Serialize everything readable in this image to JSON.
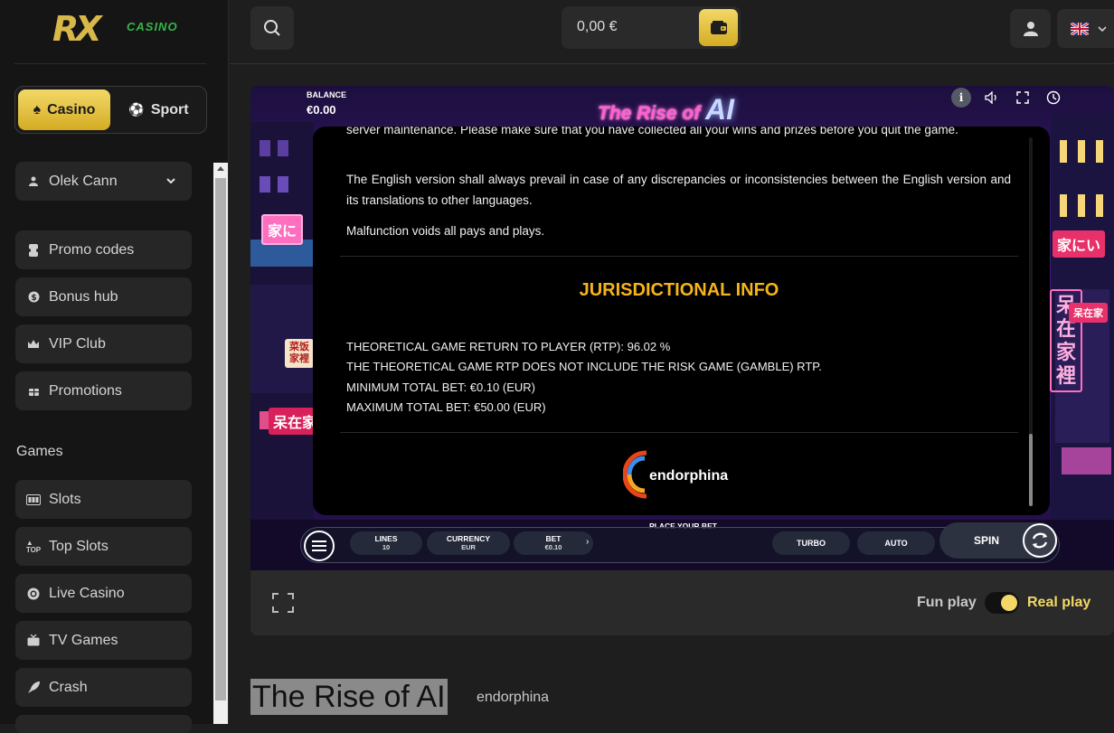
{
  "brand": {
    "logo_text": "RX",
    "logo_sub": "CASINO"
  },
  "mode_switch": {
    "casino_label": "Casino",
    "sport_label": "Sport"
  },
  "user": {
    "name": "Olek Cann"
  },
  "nav": {
    "items": [
      {
        "label": "Promo codes",
        "icon": "ticket-icon"
      },
      {
        "label": "Bonus hub",
        "icon": "coin-icon"
      },
      {
        "label": "VIP Club",
        "icon": "crown-icon"
      },
      {
        "label": "Promotions",
        "icon": "gift-icon"
      }
    ],
    "games_label": "Games",
    "game_items": [
      {
        "label": "Slots",
        "icon": "slots-icon"
      },
      {
        "label": "Top Slots",
        "icon": "top-icon"
      },
      {
        "label": "Live Casino",
        "icon": "chip-icon"
      },
      {
        "label": "TV Games",
        "icon": "tv-icon"
      },
      {
        "label": "Crash",
        "icon": "rocket-icon"
      }
    ]
  },
  "topbar": {
    "balance": "0,00 €"
  },
  "game": {
    "balance_label": "BALANCE",
    "balance_value": "€0.00",
    "title_main": "The Rise of",
    "title_ai": "AI",
    "modal": {
      "text_1": "server maintenance. Please make sure that you have collected all your wins and prizes before you quit the game.",
      "text_2": "The English version shall always prevail in case of any discrepancies or inconsistencies between the English version and its translations to other languages.",
      "text_3": "Malfunction voids all pays and plays.",
      "heading": "JURISDICTIONAL INFO",
      "rtp_lines": [
        "THEORETICAL GAME RETURN TO PLAYER (RTP): 96.02 %",
        "THE THEORETICAL GAME RTP DOES NOT INCLUDE THE RISK GAME (GAMBLE) RTP.",
        "MINIMUM TOTAL BET: €0.10 (EUR)",
        "MAXIMUM TOTAL BET: €50.00 (EUR)"
      ],
      "provider_logo_text": "endorphina"
    },
    "controls": {
      "place_bet": "PLACE YOUR BET",
      "lines_label": "LINES",
      "lines_value": "10",
      "currency_label": "CURRENCY",
      "currency_value": "EUR",
      "bet_label": "BET",
      "bet_value": "€0.10",
      "turbo_label": "TURBO",
      "auto_label": "AUTO",
      "spin_label": "SPIN"
    }
  },
  "footer": {
    "fun_play": "Fun play",
    "real_play": "Real play"
  },
  "page": {
    "title": "The Rise of AI",
    "provider": "endorphina"
  },
  "colors": {
    "accent": "#f3d867",
    "heading": "#f6b41b",
    "brand_green": "#35b54a"
  }
}
